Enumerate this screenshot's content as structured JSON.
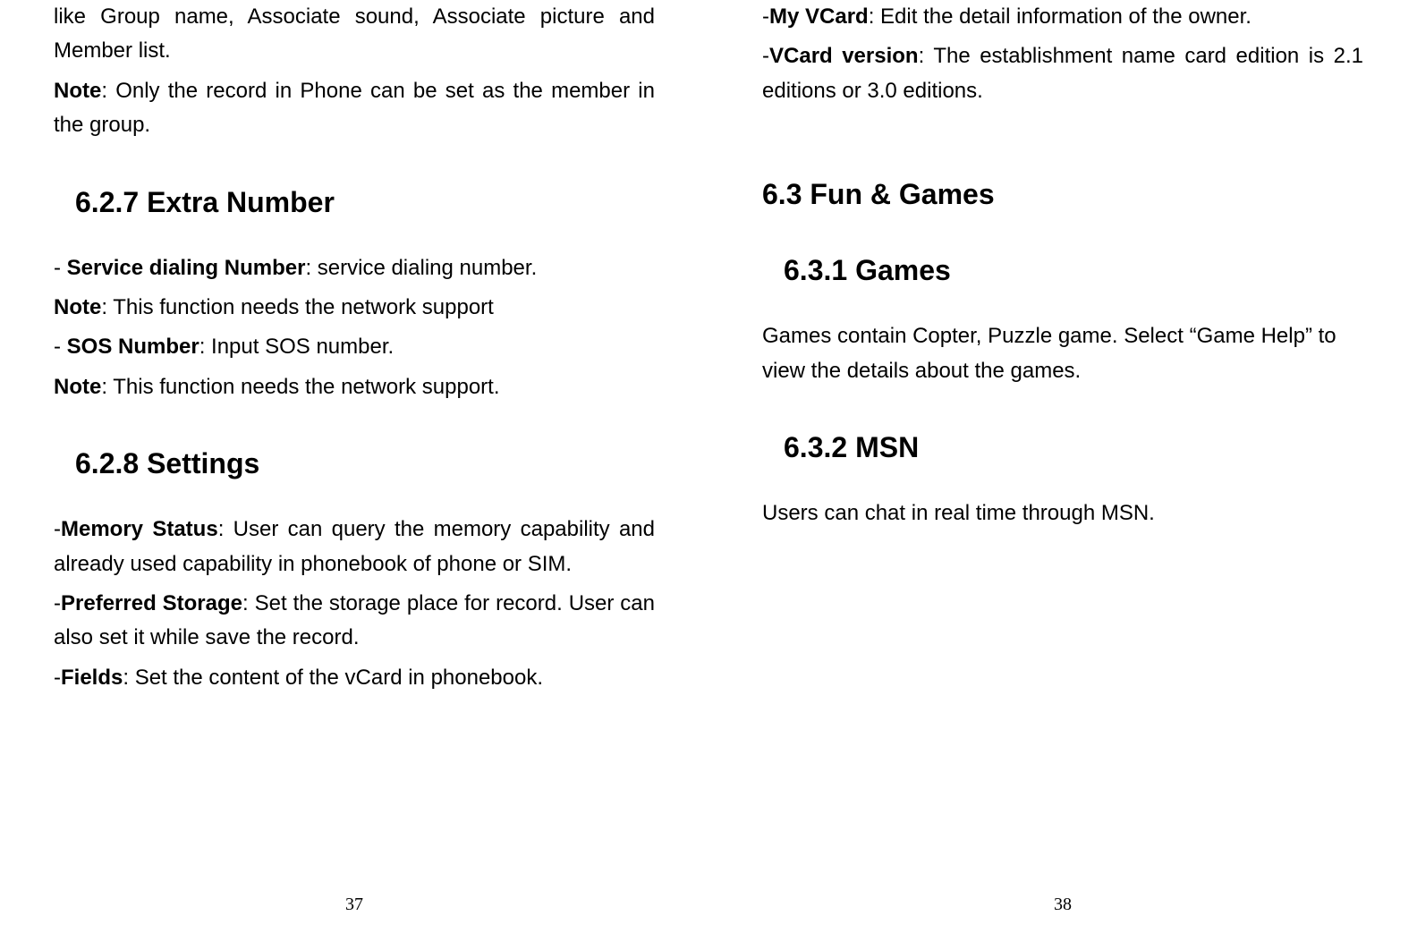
{
  "left": {
    "para1": "like Group name, Associate sound, Associate picture and Member list.",
    "note1_label": "Note",
    "note1_text": ": Only the record in Phone can be set as the member in the group.",
    "h_627": "6.2.7 Extra Number",
    "sdn_label": "Service dialing Number",
    "sdn_text": ": service dialing number.",
    "note2_label": "Note",
    "note2_text": ": This function needs the network support",
    "sos_label": "SOS Number",
    "sos_text": ": Input SOS number.",
    "note3_label": "Note",
    "note3_text": ": This function needs the network support.",
    "h_628": "6.2.8 Settings",
    "mem_label": "Memory Status",
    "mem_text": ": User can query the memory capability and already used capability in phonebook of phone or SIM.",
    "pref_label": "Preferred Storage",
    "pref_text": ": Set the storage place for record. User can also set it while save the record.",
    "fields_label": "Fields",
    "fields_text": ": Set the content of the vCard in phonebook.",
    "page_num": "37"
  },
  "right": {
    "vcard_label": "My VCard",
    "vcard_text": ": Edit the detail information of the owner.",
    "vver_label": "VCard version",
    "vver_text": ": The establishment name card edition is 2.1 editions or 3.0 editions.",
    "h_63": "6.3 Fun & Games",
    "h_631": "6.3.1 Games",
    "games_text": "Games contain Copter, Puzzle game. Select “Game Help” to view the details about the games.",
    "h_632": "6.3.2 MSN",
    "msn_text": "Users can chat in real time through MSN.",
    "page_num": "38"
  }
}
